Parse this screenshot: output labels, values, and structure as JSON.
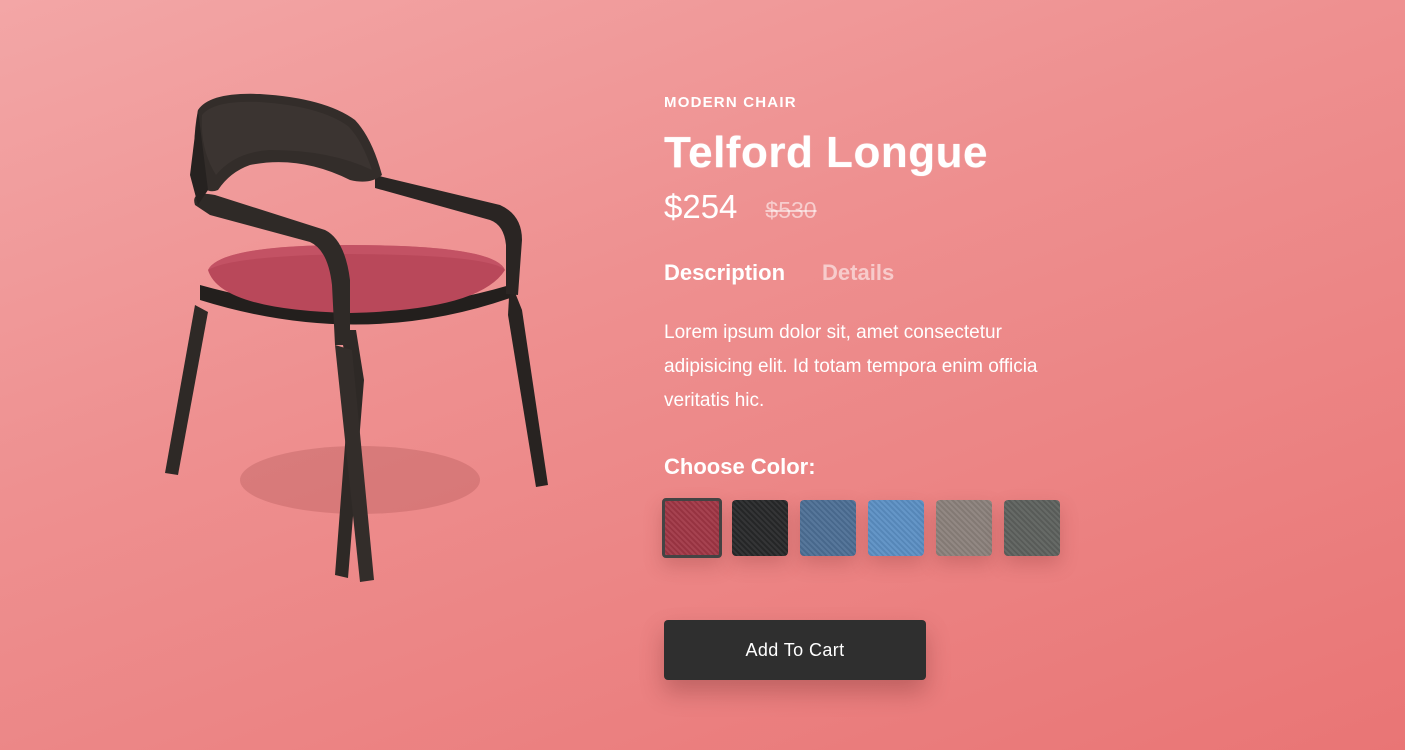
{
  "product": {
    "category": "MODERN CHAIR",
    "title": "Telford Longue",
    "price_current": "$254",
    "price_old": "$530"
  },
  "tabs": [
    {
      "label": "Description",
      "active": true
    },
    {
      "label": "Details",
      "active": false
    }
  ],
  "description": "Lorem ipsum dolor sit, amet consectetur adipisicing elit. Id totam tempora enim officia veritatis hic.",
  "color_picker": {
    "label": "Choose Color:",
    "swatches": [
      {
        "name": "burgundy",
        "color": "#a03645",
        "selected": true
      },
      {
        "name": "black",
        "color": "#272829",
        "selected": false
      },
      {
        "name": "denim-blue",
        "color": "#4d6f95",
        "selected": false
      },
      {
        "name": "sky-blue",
        "color": "#5b8fc4",
        "selected": false
      },
      {
        "name": "taupe",
        "color": "#8b817b",
        "selected": false
      },
      {
        "name": "charcoal-grey",
        "color": "#5d615d",
        "selected": false
      }
    ]
  },
  "cart": {
    "button_label": "Add To Cart"
  },
  "colors": {
    "background_top": "#f3a6a6",
    "background_bottom": "#e97575",
    "button_bg": "#2f2f2f",
    "chair_wood": "#2e2926",
    "chair_seat": "#b9485a"
  }
}
